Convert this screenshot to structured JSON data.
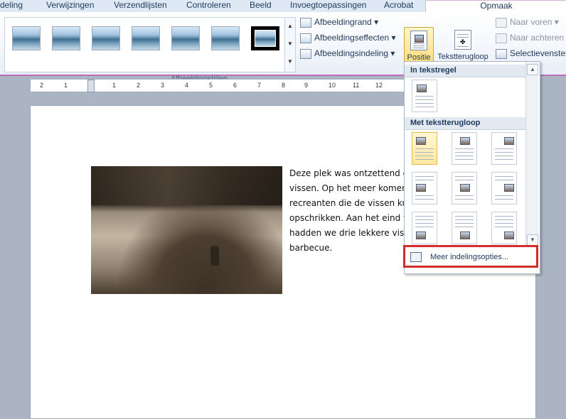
{
  "tabs": [
    {
      "label": "deling"
    },
    {
      "label": "Verwijzingen"
    },
    {
      "label": "Verzendlijsten"
    },
    {
      "label": "Controleren"
    },
    {
      "label": "Beeld"
    },
    {
      "label": "Invoegtoepassingen"
    },
    {
      "label": "Acrobat"
    },
    {
      "label": "Opmaak"
    }
  ],
  "ribbon": {
    "group_label": "Afbeeldingstijlen",
    "commands": {
      "afbeeldingsrand": "Afbeeldingrand",
      "afbeeldingseffecten": "Afbeeldingseffecten",
      "afbeeldingsindeling": "Afbeeldingsindeling",
      "positie": "Positie",
      "tekstterugloop": "Tekstterugloop",
      "naar_voren": "Naar voren",
      "naar_achteren": "Naar achteren",
      "selectievenster": "Selectievenster"
    }
  },
  "ruler": {
    "ticks": [
      "2",
      "1",
      "1",
      "2",
      "3",
      "4",
      "5",
      "6",
      "7",
      "8",
      "9",
      "10",
      "11",
      "12"
    ]
  },
  "document": {
    "paragraph": "Deze plek was ontzettend go\nvissen. Op het meer komen \nrecreanten die de vissen kun\nopschrikken. Aan het eind v\nhadden we drie lekkere visje\nbarbecue."
  },
  "dropdown": {
    "section_inline": "In tekstregel",
    "section_wrap": "Met tekstterugloop",
    "more_options": "Meer indelingsopties..."
  },
  "colors": {
    "accent_border": "#c06ab8",
    "highlight": "#ffd66a",
    "callout_red": "#d42b2b"
  }
}
